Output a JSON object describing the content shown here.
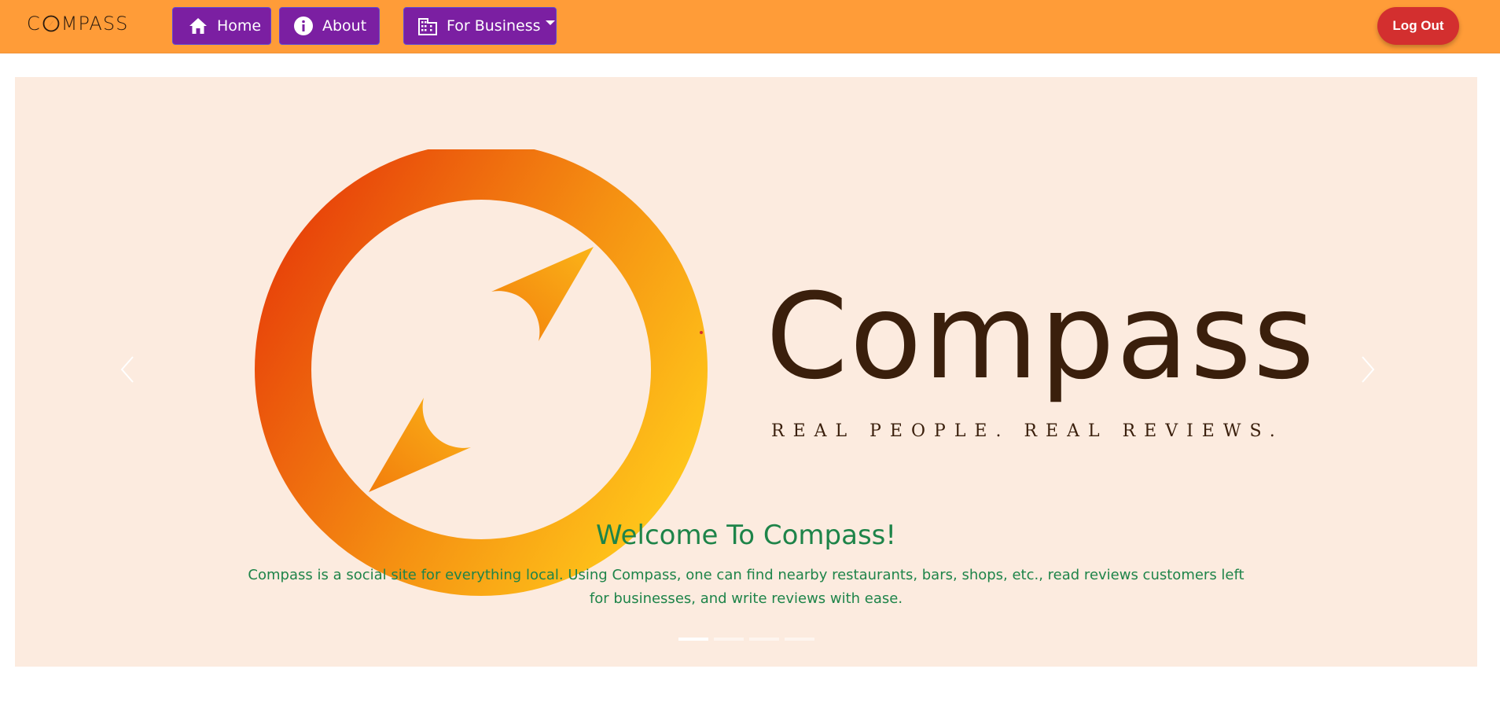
{
  "navbar": {
    "brand": {
      "c": "C",
      "rest": "MPASS"
    },
    "home_label": "Home",
    "about_label": "About",
    "business_label": "For Business",
    "logout_label": "Log Out"
  },
  "hero": {
    "wordmark": "Compass",
    "tagline": "REAL PEOPLE. REAL REVIEWS.",
    "caption_title": "Welcome To Compass!",
    "caption_text": "Compass is a social site for everything local. Using Compass, one can find nearby restaurants, bars, shops, etc., read reviews customers left for businesses, and write reviews with ease.",
    "slides": {
      "count": 4,
      "active": 1
    }
  },
  "colors": {
    "navbar": "#ff9c38",
    "nav_button": "#7b1fa2",
    "logout": "#d32f2f",
    "hero_background": "#fcebdf",
    "caption": "#1e8449",
    "wordmark": "#3a1f0c"
  },
  "icons": {
    "home": "home-icon",
    "about": "info-icon",
    "business": "building-icon",
    "prev": "chevron-left-icon",
    "next": "chevron-right-icon",
    "logo": "compass-icon"
  }
}
